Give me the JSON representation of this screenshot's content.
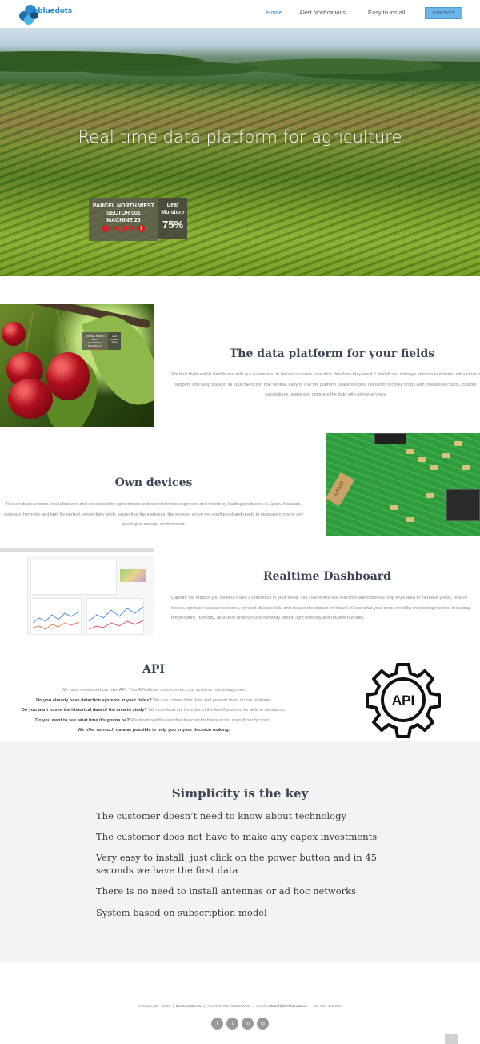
{
  "brand": {
    "name": "thebluedots",
    "accent": "#2a8ad0"
  },
  "nav": {
    "items": [
      {
        "label": "Home",
        "active": true
      },
      {
        "label": "Alert Notifications",
        "active": false
      },
      {
        "label": "Easy to install",
        "active": false
      }
    ],
    "contact": "CONTACT"
  },
  "hero": {
    "title": "Real time data platform for agriculture",
    "alert": {
      "line1": "PARCEL NORTH WEST",
      "line2": "SECTOR 001",
      "line3": "MACHINE 23",
      "alert_label": "ALERT",
      "alert_icon": "!"
    },
    "moisture": {
      "label1": "Leaf",
      "label2": "Moisture",
      "value": "75%"
    }
  },
  "section_platform": {
    "title": "The data platform for your fields",
    "text": "We built thebluedots dashboard with our customers, to deliver accurate, real-time data how they need it. Install and manage sensors in minutes without tech support, and keep track of all your metrics in one central, easy to use the platform. Make the best decisions for your crops with interactive charts, custom calculations, alerts and compare the data with previous years",
    "image": "cherries-with-sensor-overlay",
    "mini_alert": {
      "line1": "PARCEL NORTH WEST",
      "line2": "SECTOR 001",
      "line3": "MACHINE 23",
      "label": "ALERT"
    },
    "mini_moisture": {
      "line1": "Leaf",
      "line2": "Moisture",
      "value": "75%"
    }
  },
  "section_devices": {
    "title": "Own devices",
    "text": "These robust sensors, manufactured and developed by agronomists and our electronic engineers and tested by leading producers in Spain. Accurate, compact, hermetic and built for perfect connectivity while supporting the elements, the sensors arrive pre-configured and ready to measure crops in any growing or storage environment.",
    "image": "circuit-board",
    "chip_label": "CAS10"
  },
  "section_dashboard": {
    "title": "Realtime Dashboard",
    "text": "Capture the metrics you need to make a difference in your fields. Our customers use real-time and historical crop-level data to increase yields, reduce losses, optimize natural resources, prevent disease risk, and reduce the impact on nature. Know what your crops need by monitoring metrics, including temperature, humidity, air and/or underground humidity deficit, light intensity and relative humidity.",
    "image": "dashboard-screenshot"
  },
  "section_api": {
    "title": "API",
    "lines": [
      {
        "bold": "",
        "text": "We have developed our own API. This API allows us to connect our systems to existing ones."
      },
      {
        "bold": "Do you already have detection systems in your fields?",
        "text": " We can connect the data and present them on our platform."
      },
      {
        "bold": "Do you want to see the historical data of the area to study?",
        "text": " We download the histories of the last 8 years to be able to deviations."
      },
      {
        "bold": "Do you want to see what time it's gonna be?",
        "text": " We download the weather forecast for the next ten days (hour by hour)."
      },
      {
        "bold": "We offer as much data as possible to help you in your decision making.",
        "text": ""
      }
    ],
    "icon_label": "API",
    "icon": "api-gear-icon"
  },
  "simplicity": {
    "title": "Simplicity is the key",
    "items": [
      "The customer doesn’t need to know about technology",
      "The customer does not have to make any capex investments",
      "Very easy to install, just click on the power button and in 45 seconds we have the first data",
      "There is no need to install antennas or ad hoc networks",
      "System based on subscription model"
    ]
  },
  "footer": {
    "copyright": "© Copyright - 2020",
    "company": "thebluedots SL",
    "rights": "ALL RIGHTS RESERVED",
    "email_label": "email:",
    "email": "eduard@thebluedots.io",
    "phone": "+34 678 450 030",
    "socials": [
      {
        "name": "facebook",
        "glyph": "f"
      },
      {
        "name": "twitter",
        "glyph": "t"
      },
      {
        "name": "linkedin",
        "glyph": "in"
      },
      {
        "name": "instagram",
        "glyph": "◎"
      }
    ],
    "totop_glyph": "^"
  }
}
